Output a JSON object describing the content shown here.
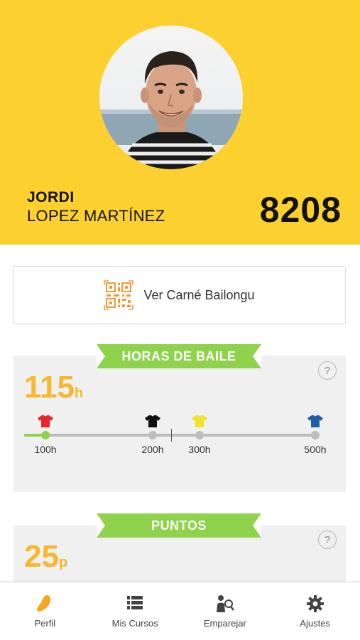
{
  "profile": {
    "first_name": "JORDI",
    "last_name": "LOPEZ MARTÍNEZ",
    "number": "8208",
    "avatar_icon": "user-photo"
  },
  "card_button": {
    "label": "Ver Carné Bailongu",
    "icon": "qr-code-icon"
  },
  "hours_section": {
    "title": "HORAS DE BAILE",
    "value": "115",
    "unit": "h",
    "help": "?",
    "progress_hours": 115,
    "milestones": [
      {
        "label": "100h",
        "hours": 100,
        "shirt_color": "#e8262a"
      },
      {
        "label": "200h",
        "hours": 200,
        "shirt_color": "#111111"
      },
      {
        "label": "300h",
        "hours": 300,
        "shirt_color": "#f2e32a"
      },
      {
        "label": "500h",
        "hours": 500,
        "shirt_color": "#1d5fa8"
      }
    ]
  },
  "points_section": {
    "title": "PUNTOS",
    "value": "25",
    "unit": "p",
    "help": "?"
  },
  "bottom_nav": {
    "items": [
      {
        "label": "Perfil",
        "icon": "footprint-icon",
        "active": true
      },
      {
        "label": "Mis Cursos",
        "icon": "list-icon",
        "active": false
      },
      {
        "label": "Emparejar",
        "icon": "person-search-icon",
        "active": false
      },
      {
        "label": "Ajustes",
        "icon": "gear-icon",
        "active": false
      }
    ]
  },
  "colors": {
    "header_bg": "#fcd12f",
    "accent_green": "#8fd24b",
    "value_orange": "#f7b731",
    "active_icon": "#f5a623"
  }
}
